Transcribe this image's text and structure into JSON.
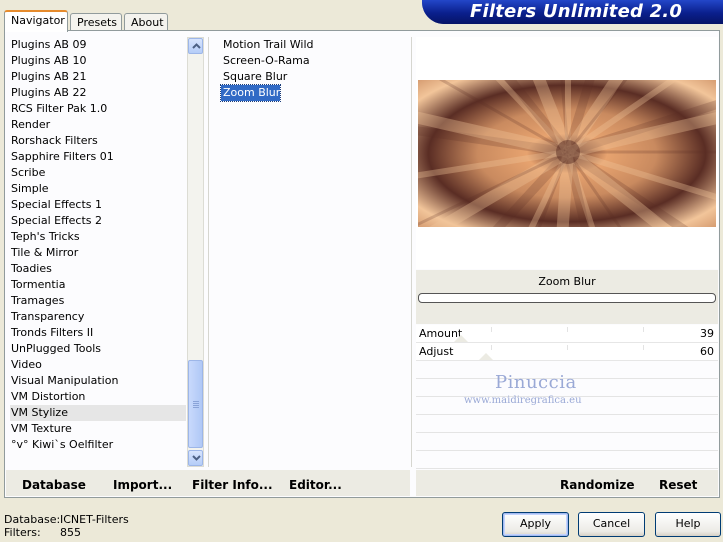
{
  "window": {
    "title": "Filters Unlimited 2.0"
  },
  "tabs": [
    {
      "label": "Navigator",
      "active": true
    },
    {
      "label": "Presets",
      "active": false
    },
    {
      "label": "About",
      "active": false
    }
  ],
  "categories": {
    "items": [
      "Plugins AB 09",
      "Plugins AB 10",
      "Plugins AB 21",
      "Plugins AB 22",
      "RCS Filter Pak 1.0",
      "Render",
      "Rorshack Filters",
      "Sapphire Filters 01",
      "Scribe",
      "Simple",
      "Special Effects 1",
      "Special Effects 2",
      "Teph's Tricks",
      "Tile & Mirror",
      "Toadies",
      "Tormentia",
      "Tramages",
      "Transparency",
      "Tronds Filters II",
      "UnPlugged Tools",
      "Video",
      "Visual Manipulation",
      "VM Distortion",
      "VM Stylize",
      "VM Texture",
      "°v° Kiwi`s Oelfilter"
    ],
    "selected": "VM Stylize"
  },
  "filters": {
    "items": [
      "Motion Trail Wild",
      "Screen-O-Rama",
      "Square Blur",
      "Zoom Blur"
    ],
    "selected": "Zoom Blur"
  },
  "preview": {
    "filter_name": "Zoom Blur",
    "colors": {
      "light": "#f2c59a",
      "mid": "#c98a5f",
      "dark": "#5a2d24",
      "accent": "#e7a36f"
    }
  },
  "params": [
    {
      "label": "Amount",
      "value": "39"
    },
    {
      "label": "Adjust",
      "value": "60"
    }
  ],
  "watermark": {
    "name": "Pinuccia",
    "url": "www.maidiregrafica.eu"
  },
  "toolbar": {
    "database": "Database",
    "import": "Import...",
    "filter_info": "Filter Info...",
    "editor": "Editor...",
    "randomize": "Randomize",
    "reset": "Reset"
  },
  "status": {
    "database_label": "Database:",
    "database_value": "ICNET-Filters",
    "filters_label": "Filters:",
    "filters_value": "855"
  },
  "buttons": {
    "apply": "Apply",
    "cancel": "Cancel",
    "help": "Help"
  },
  "theme": {
    "banner": "#0a1f8c",
    "selection": "#316ac5",
    "tab_accent": "#e68b2c"
  }
}
